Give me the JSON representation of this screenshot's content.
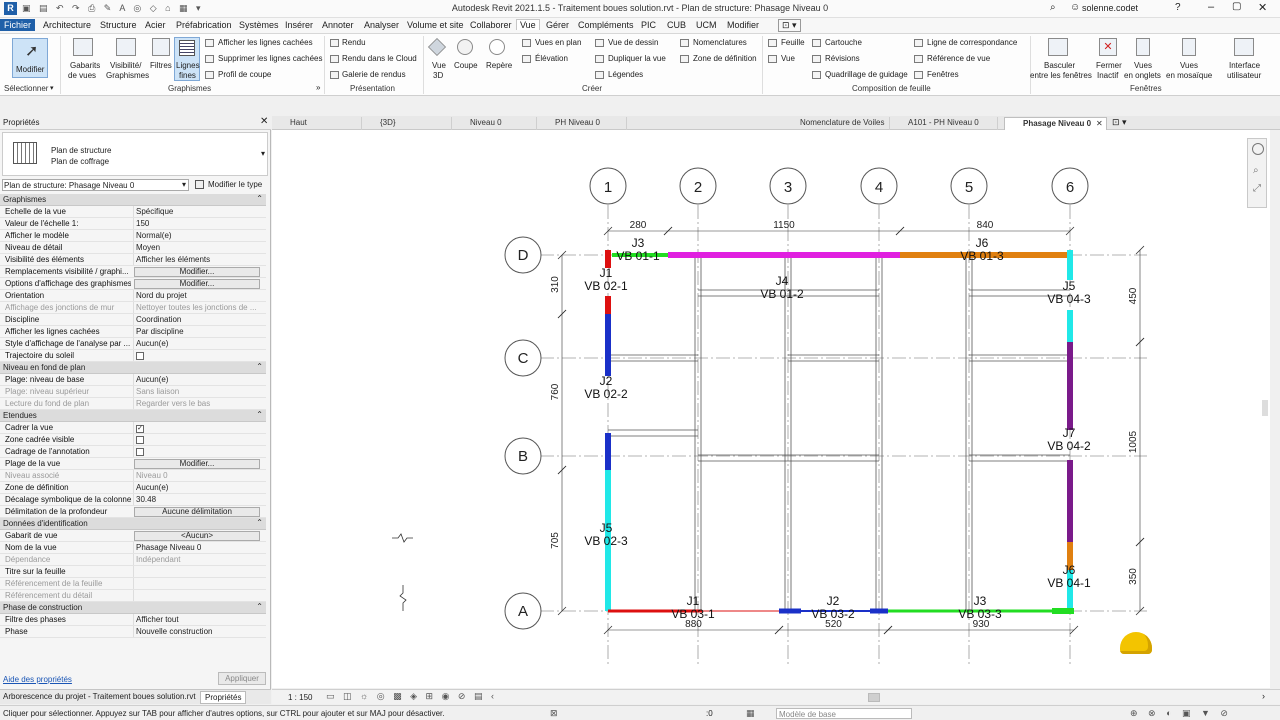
{
  "window": {
    "title": "Autodesk Revit 2021.1.5 - Traitement boues solution.rvt - Plan de structure: Phasage Niveau 0",
    "user": "solenne.codet"
  },
  "menu": [
    "Fichier",
    "Architecture",
    "Structure",
    "Acier",
    "Préfabrication",
    "Systèmes",
    "Insérer",
    "Annoter",
    "Analyser",
    "Volume et site",
    "Collaborer",
    "Vue",
    "Gérer",
    "Compléments",
    "PIC",
    "CUB",
    "UCM",
    "Modifier"
  ],
  "ribbon": {
    "modifier": "Modifier",
    "selectionner": "Sélectionner",
    "gabarits": [
      "Gabarits",
      "de vues"
    ],
    "visibilite": [
      "Visibilité/",
      "Graphismes"
    ],
    "filtres": "Filtres",
    "lignes_fines": [
      "Lignes",
      "fines"
    ],
    "g1": [
      "Afficher les lignes cachées",
      "Supprimer les lignes cachées",
      "Profil de coupe"
    ],
    "graphismes": "Graphismes",
    "rendu": [
      "Rendu",
      "Rendu dans le Cloud",
      "Galerie de rendus"
    ],
    "presentation": "Présentation",
    "vue3d": [
      "Vue",
      "3D"
    ],
    "coupe": "Coupe",
    "repere": "Repère",
    "creer1": [
      "Vues en plan",
      "Élévation"
    ],
    "creer2": [
      "Vue de dessin",
      "Dupliquer la vue",
      "Légendes"
    ],
    "creer3": [
      "Nomenclatures",
      "Zone de définition"
    ],
    "creer": "Créer",
    "feuille": [
      "Feuille",
      "Vue"
    ],
    "comp1": [
      "Cartouche",
      "Révisions",
      "Quadrillage de guidage"
    ],
    "comp2": [
      "Ligne de correspondance",
      "Référence de vue",
      "Fenêtres"
    ],
    "composition": "Composition de feuille",
    "basculer": [
      "Basculer",
      "entre les fenêtres"
    ],
    "fermer": [
      "Fermer",
      "Inactif"
    ],
    "onglets": [
      "Vues",
      "en onglets"
    ],
    "mosaique": [
      "Vues",
      "en mosaïque"
    ],
    "interface": [
      "Interface",
      "utilisateur"
    ],
    "fenetres": "Fenêtres"
  },
  "properties": {
    "panel_title": "Propriétés",
    "type_name": [
      "Plan de structure",
      "Plan de coffrage"
    ],
    "instance": "Plan de structure: Phasage Niveau 0",
    "modify_type": "Modifier le type",
    "rows": [
      {
        "s": "Graphismes"
      },
      {
        "k": "Echelle de la vue",
        "v": "Spécifique"
      },
      {
        "k": "Valeur de l'échelle    1:",
        "v": "150"
      },
      {
        "k": "Afficher le modèle",
        "v": "Normal(e)"
      },
      {
        "k": "Niveau de détail",
        "v": "Moyen"
      },
      {
        "k": "Visibilité des éléments",
        "v": "Afficher les éléments"
      },
      {
        "k": "Remplacements visibilité / graphi...",
        "b": "Modifier..."
      },
      {
        "k": "Options d'affichage des graphismes",
        "b": "Modifier..."
      },
      {
        "k": "Orientation",
        "v": "Nord du projet"
      },
      {
        "k": "Affichage des jonctions de mur",
        "v": "Nettoyer toutes les jonctions de ...",
        "d": 1
      },
      {
        "k": "Discipline",
        "v": "Coordination"
      },
      {
        "k": "Afficher les lignes cachées",
        "v": "Par discipline"
      },
      {
        "k": "Style d'affichage de l'analyse par ...",
        "v": "Aucun(e)"
      },
      {
        "k": "Trajectoire du soleil",
        "c": 0
      },
      {
        "s": "Niveau en fond de plan"
      },
      {
        "k": "Plage: niveau de base",
        "v": "Aucun(e)"
      },
      {
        "k": "Plage: niveau supérieur",
        "v": "Sans liaison",
        "d": 1
      },
      {
        "k": "Lecture du fond de plan",
        "v": "Regarder vers le bas",
        "d": 1
      },
      {
        "s": "Etendues"
      },
      {
        "k": "Cadrer la vue",
        "c": 1
      },
      {
        "k": "Zone cadrée visible",
        "c": 0
      },
      {
        "k": "Cadrage de l'annotation",
        "c": 0
      },
      {
        "k": "Plage de la vue",
        "b": "Modifier..."
      },
      {
        "k": "Niveau associé",
        "v": "Niveau 0",
        "d": 1
      },
      {
        "k": "Zone de définition",
        "v": "Aucun(e)"
      },
      {
        "k": "Décalage symbolique de la colonne",
        "v": "30.48"
      },
      {
        "k": "Délimitation de la profondeur",
        "b": "Aucune délimitation"
      },
      {
        "s": "Données d'identification"
      },
      {
        "k": "Gabarit de vue",
        "b": "<Aucun>"
      },
      {
        "k": "Nom de la vue",
        "v": "Phasage Niveau 0"
      },
      {
        "k": "Dépendance",
        "v": "Indépendant",
        "d": 1
      },
      {
        "k": "Titre sur la feuille",
        "v": ""
      },
      {
        "k": "Référencement de la feuille",
        "v": "",
        "d": 1
      },
      {
        "k": "Référencement du détail",
        "v": "",
        "d": 1
      },
      {
        "s": "Phase de construction"
      },
      {
        "k": "Filtre des phases",
        "v": "Afficher tout"
      },
      {
        "k": "Phase",
        "v": "Nouvelle construction"
      }
    ],
    "help": "Aide des propriétés",
    "apply": "Appliquer"
  },
  "bottom_tabs": [
    "Arborescence du projet - Traitement boues solution.rvt",
    "Propriétés"
  ],
  "view_tabs": [
    "Haut",
    "{3D}",
    "Niveau 0",
    "PH Niveau 0",
    "Nomenclature de Voiles",
    "A101 - PH Niveau 0",
    "Phasage Niveau 0"
  ],
  "plan": {
    "col_grids": [
      "1",
      "2",
      "3",
      "4",
      "5",
      "6"
    ],
    "row_grids": [
      "D",
      "C",
      "B",
      "A"
    ],
    "top_dims": [
      "280",
      "1150",
      "840"
    ],
    "bottom_dims": [
      "880",
      "520",
      "930"
    ],
    "left_dims": [
      "310",
      "760",
      "705"
    ],
    "right_dims": [
      "450",
      "1005",
      "350"
    ],
    "labels": [
      {
        "j": "J3",
        "vb": "VB 01-1"
      },
      {
        "j": "J6",
        "vb": "VB 01-3"
      },
      {
        "j": "J1",
        "vb": "VB 02-1"
      },
      {
        "j": "J4",
        "vb": "VB 01-2"
      },
      {
        "j": "J5",
        "vb": "VB 04-3"
      },
      {
        "j": "J2",
        "vb": "VB 02-2"
      },
      {
        "j": "J7",
        "vb": "VB 04-2"
      },
      {
        "j": "J5",
        "vb": "VB 02-3"
      },
      {
        "j": "J6",
        "vb": "VB 04-1"
      },
      {
        "j": "J1",
        "vb": "VB 03-1"
      },
      {
        "j": "J2",
        "vb": "VB 03-2"
      },
      {
        "j": "J3",
        "vb": "VB 03-3"
      }
    ],
    "colors": {
      "magenta": "#e020e0",
      "orange": "#e08010",
      "red": "#dd1010",
      "blue": "#1a30c8",
      "cyan": "#20e8e8",
      "purple": "#7a1a8a",
      "green": "#22dd22"
    }
  },
  "view_control": {
    "scale": "1 : 150",
    "zero": ":0",
    "model": "Modèle de base"
  },
  "status": "Cliquer pour sélectionner. Appuyez sur TAB pour afficher d'autres options, sur CTRL pour ajouter et sur MAJ pour désactiver."
}
